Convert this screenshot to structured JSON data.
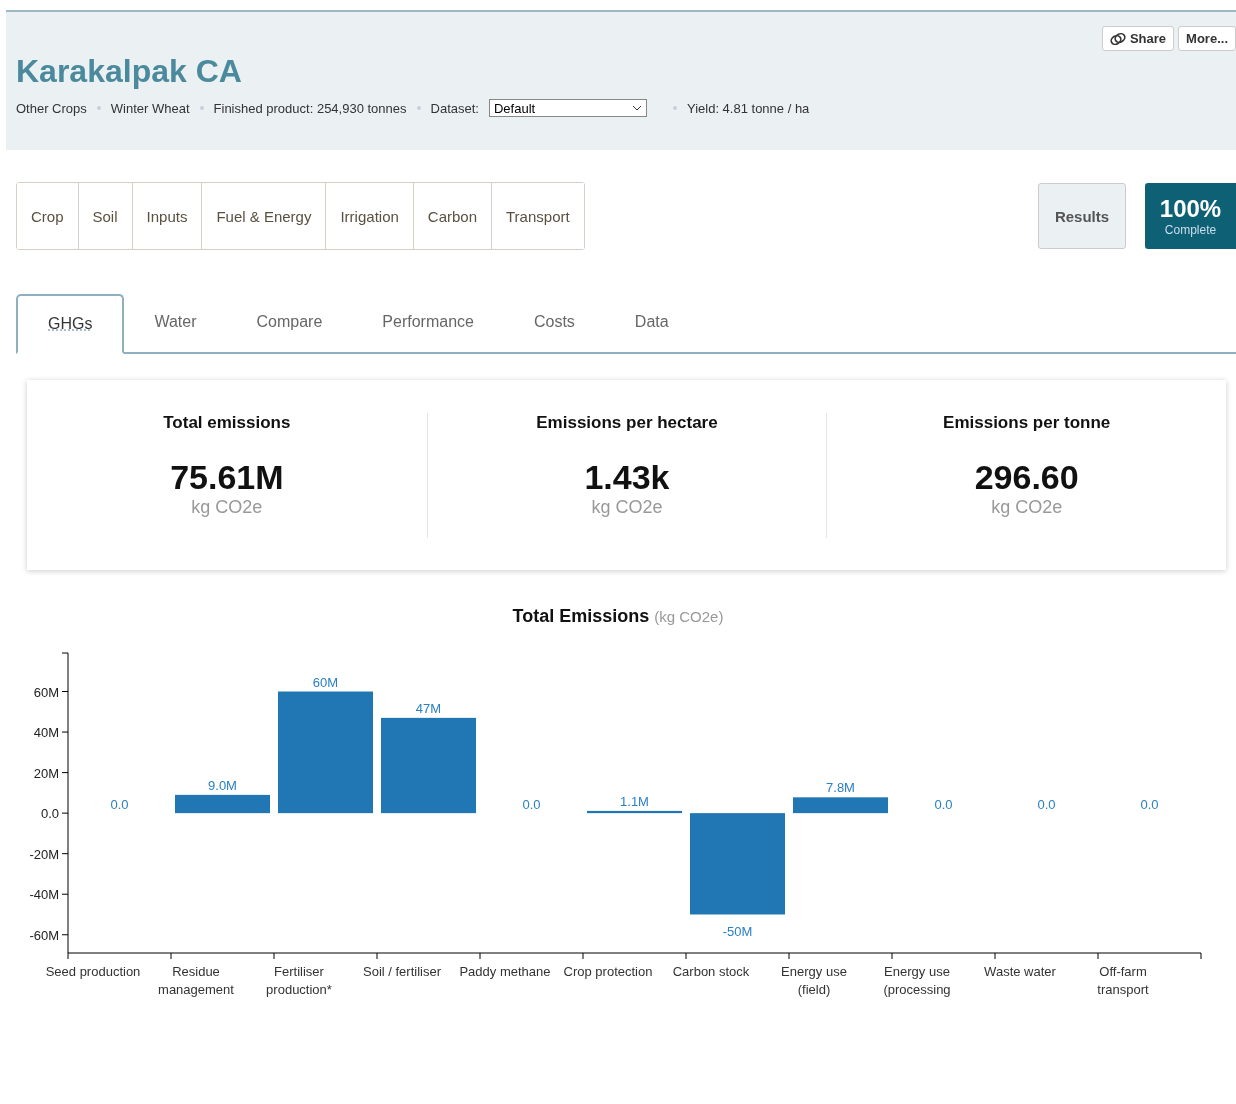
{
  "header": {
    "title": "Karakalpak CA",
    "actions": [
      "Share",
      "More..."
    ],
    "meta": [
      {
        "kind": "text",
        "text": "Other Crops"
      },
      {
        "kind": "text",
        "text": "Winter Wheat"
      },
      {
        "kind": "text",
        "text": "Finished product: 254,930 tonnes"
      },
      {
        "kind": "select",
        "label": "Dataset:",
        "value": "Default"
      },
      {
        "kind": "text",
        "text": "Yield: 4.81 tonne / ha"
      }
    ]
  },
  "sections": [
    {
      "label": "Crop"
    },
    {
      "label": "Soil"
    },
    {
      "label": "Inputs"
    },
    {
      "label": "Fuel & Energy"
    },
    {
      "label": "Irrigation"
    },
    {
      "label": "Carbon"
    },
    {
      "label": "Transport"
    }
  ],
  "results_button": "Results",
  "progress": {
    "percent": "100%",
    "label": "Complete"
  },
  "tabs": [
    {
      "label": "GHGs",
      "selected": true
    },
    {
      "label": "Water",
      "selected": false
    },
    {
      "label": "Compare",
      "selected": false
    },
    {
      "label": "Performance",
      "selected": false
    },
    {
      "label": "Costs",
      "selected": false
    },
    {
      "label": "Data",
      "selected": false
    }
  ],
  "summary": [
    {
      "title": "Total emissions",
      "value": "75.61M",
      "unit": "kg CO2e"
    },
    {
      "title": "Emissions per hectare",
      "value": "1.43k",
      "unit": "kg CO2e"
    },
    {
      "title": "Emissions per tonne",
      "value": "296.60",
      "unit": "kg CO2e"
    }
  ],
  "chart_data": {
    "type": "bar",
    "title": "Total Emissions",
    "ylabel": "(kg CO2e)",
    "categories": [
      "Seed production",
      "Residue management",
      "Fertiliser production*",
      "Soil / fertiliser",
      "Paddy methane",
      "Crop protection",
      "Carbon stock",
      "Energy use (field)",
      "Energy use (processing",
      "Waste water",
      "Off-farm transport"
    ],
    "series": [
      {
        "color": "#2077b4",
        "values": [
          0,
          9000000,
          60000000,
          47000000,
          0,
          1100000,
          -50000000,
          7800000,
          0,
          0,
          0
        ]
      }
    ],
    "value_labels": [
      "0.0",
      "9.0M",
      "60M",
      "47M",
      "0.0",
      "1.1M",
      "-50M",
      "7.8M",
      "0.0",
      "0.0",
      "0.0"
    ],
    "ylim": [
      -69000000,
      79000000
    ],
    "yticks": [
      {
        "value": 60000000,
        "label": "60M"
      },
      {
        "value": 40000000,
        "label": "40M"
      },
      {
        "value": 20000000,
        "label": "20M"
      },
      {
        "value": 0,
        "label": "0.0"
      },
      {
        "value": -20000000,
        "label": "-20M"
      },
      {
        "value": -40000000,
        "label": "-40M"
      },
      {
        "value": -60000000,
        "label": "-60M"
      }
    ]
  }
}
